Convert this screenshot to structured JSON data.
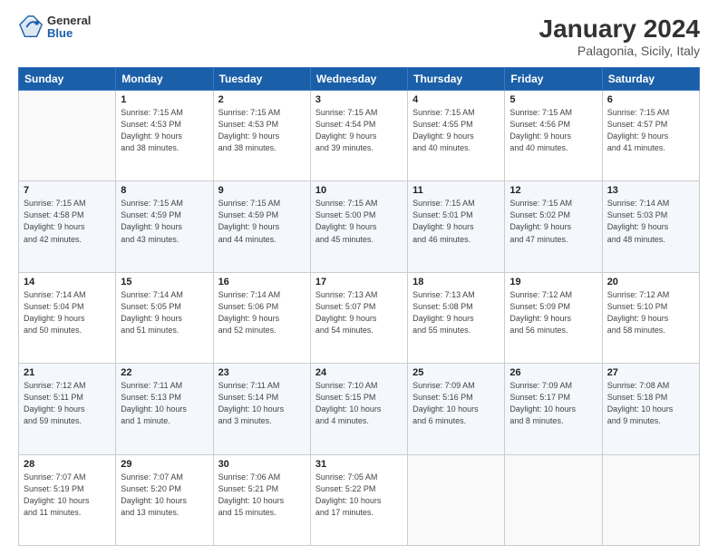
{
  "header": {
    "title": "January 2024",
    "subtitle": "Palagonia, Sicily, Italy",
    "logo_general": "General",
    "logo_blue": "Blue"
  },
  "days_of_week": [
    "Sunday",
    "Monday",
    "Tuesday",
    "Wednesday",
    "Thursday",
    "Friday",
    "Saturday"
  ],
  "weeks": [
    [
      {
        "day": "",
        "info": ""
      },
      {
        "day": "1",
        "info": "Sunrise: 7:15 AM\nSunset: 4:53 PM\nDaylight: 9 hours\nand 38 minutes."
      },
      {
        "day": "2",
        "info": "Sunrise: 7:15 AM\nSunset: 4:53 PM\nDaylight: 9 hours\nand 38 minutes."
      },
      {
        "day": "3",
        "info": "Sunrise: 7:15 AM\nSunset: 4:54 PM\nDaylight: 9 hours\nand 39 minutes."
      },
      {
        "day": "4",
        "info": "Sunrise: 7:15 AM\nSunset: 4:55 PM\nDaylight: 9 hours\nand 40 minutes."
      },
      {
        "day": "5",
        "info": "Sunrise: 7:15 AM\nSunset: 4:56 PM\nDaylight: 9 hours\nand 40 minutes."
      },
      {
        "day": "6",
        "info": "Sunrise: 7:15 AM\nSunset: 4:57 PM\nDaylight: 9 hours\nand 41 minutes."
      }
    ],
    [
      {
        "day": "7",
        "info": "Sunrise: 7:15 AM\nSunset: 4:58 PM\nDaylight: 9 hours\nand 42 minutes."
      },
      {
        "day": "8",
        "info": "Sunrise: 7:15 AM\nSunset: 4:59 PM\nDaylight: 9 hours\nand 43 minutes."
      },
      {
        "day": "9",
        "info": "Sunrise: 7:15 AM\nSunset: 4:59 PM\nDaylight: 9 hours\nand 44 minutes."
      },
      {
        "day": "10",
        "info": "Sunrise: 7:15 AM\nSunset: 5:00 PM\nDaylight: 9 hours\nand 45 minutes."
      },
      {
        "day": "11",
        "info": "Sunrise: 7:15 AM\nSunset: 5:01 PM\nDaylight: 9 hours\nand 46 minutes."
      },
      {
        "day": "12",
        "info": "Sunrise: 7:15 AM\nSunset: 5:02 PM\nDaylight: 9 hours\nand 47 minutes."
      },
      {
        "day": "13",
        "info": "Sunrise: 7:14 AM\nSunset: 5:03 PM\nDaylight: 9 hours\nand 48 minutes."
      }
    ],
    [
      {
        "day": "14",
        "info": "Sunrise: 7:14 AM\nSunset: 5:04 PM\nDaylight: 9 hours\nand 50 minutes."
      },
      {
        "day": "15",
        "info": "Sunrise: 7:14 AM\nSunset: 5:05 PM\nDaylight: 9 hours\nand 51 minutes."
      },
      {
        "day": "16",
        "info": "Sunrise: 7:14 AM\nSunset: 5:06 PM\nDaylight: 9 hours\nand 52 minutes."
      },
      {
        "day": "17",
        "info": "Sunrise: 7:13 AM\nSunset: 5:07 PM\nDaylight: 9 hours\nand 54 minutes."
      },
      {
        "day": "18",
        "info": "Sunrise: 7:13 AM\nSunset: 5:08 PM\nDaylight: 9 hours\nand 55 minutes."
      },
      {
        "day": "19",
        "info": "Sunrise: 7:12 AM\nSunset: 5:09 PM\nDaylight: 9 hours\nand 56 minutes."
      },
      {
        "day": "20",
        "info": "Sunrise: 7:12 AM\nSunset: 5:10 PM\nDaylight: 9 hours\nand 58 minutes."
      }
    ],
    [
      {
        "day": "21",
        "info": "Sunrise: 7:12 AM\nSunset: 5:11 PM\nDaylight: 9 hours\nand 59 minutes."
      },
      {
        "day": "22",
        "info": "Sunrise: 7:11 AM\nSunset: 5:13 PM\nDaylight: 10 hours\nand 1 minute."
      },
      {
        "day": "23",
        "info": "Sunrise: 7:11 AM\nSunset: 5:14 PM\nDaylight: 10 hours\nand 3 minutes."
      },
      {
        "day": "24",
        "info": "Sunrise: 7:10 AM\nSunset: 5:15 PM\nDaylight: 10 hours\nand 4 minutes."
      },
      {
        "day": "25",
        "info": "Sunrise: 7:09 AM\nSunset: 5:16 PM\nDaylight: 10 hours\nand 6 minutes."
      },
      {
        "day": "26",
        "info": "Sunrise: 7:09 AM\nSunset: 5:17 PM\nDaylight: 10 hours\nand 8 minutes."
      },
      {
        "day": "27",
        "info": "Sunrise: 7:08 AM\nSunset: 5:18 PM\nDaylight: 10 hours\nand 9 minutes."
      }
    ],
    [
      {
        "day": "28",
        "info": "Sunrise: 7:07 AM\nSunset: 5:19 PM\nDaylight: 10 hours\nand 11 minutes."
      },
      {
        "day": "29",
        "info": "Sunrise: 7:07 AM\nSunset: 5:20 PM\nDaylight: 10 hours\nand 13 minutes."
      },
      {
        "day": "30",
        "info": "Sunrise: 7:06 AM\nSunset: 5:21 PM\nDaylight: 10 hours\nand 15 minutes."
      },
      {
        "day": "31",
        "info": "Sunrise: 7:05 AM\nSunset: 5:22 PM\nDaylight: 10 hours\nand 17 minutes."
      },
      {
        "day": "",
        "info": ""
      },
      {
        "day": "",
        "info": ""
      },
      {
        "day": "",
        "info": ""
      }
    ]
  ]
}
